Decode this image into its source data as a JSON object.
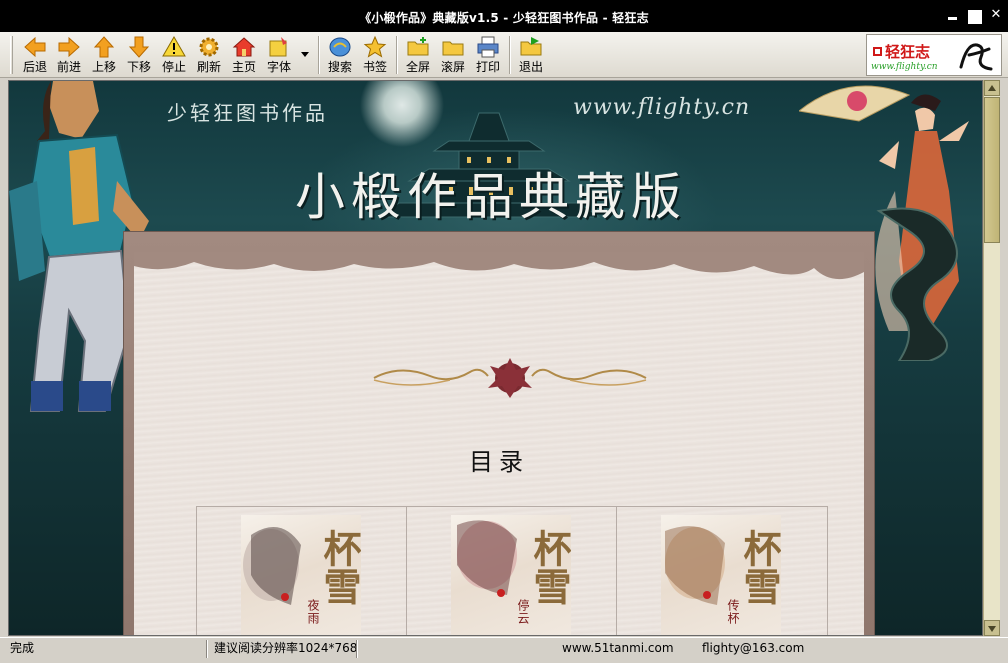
{
  "window": {
    "title": "《小椴作品》典藏版v1.5 - 少轻狂图书作品 - 轻狂志"
  },
  "toolbar": {
    "buttons": [
      {
        "label": "后退",
        "icon": "arrow-left-icon"
      },
      {
        "label": "前进",
        "icon": "arrow-right-icon"
      },
      {
        "label": "上移",
        "icon": "arrow-up-icon"
      },
      {
        "label": "下移",
        "icon": "arrow-down-icon"
      },
      {
        "label": "停止",
        "icon": "warning-icon"
      },
      {
        "label": "刷新",
        "icon": "refresh-gear-icon"
      },
      {
        "label": "主页",
        "icon": "home-icon"
      },
      {
        "label": "字体",
        "icon": "font-icon"
      },
      {
        "label": "搜索",
        "icon": "search-icon"
      },
      {
        "label": "书签",
        "icon": "star-icon"
      },
      {
        "label": "全屏",
        "icon": "folder-add-icon"
      },
      {
        "label": "滚屏",
        "icon": "folder-icon"
      },
      {
        "label": "打印",
        "icon": "printer-icon"
      },
      {
        "label": "退出",
        "icon": "exit-icon"
      }
    ],
    "logo": {
      "name": "轻狂志",
      "url": "www.flighty.cn"
    }
  },
  "banner": {
    "subtitle": "少轻狂图书作品",
    "url": "www.flighty.cn",
    "title": "小椴作品典藏版"
  },
  "toc": {
    "title": "目录",
    "books": [
      {
        "cover_big": "杯雪",
        "cover_label": "夜雨"
      },
      {
        "cover_big": "杯雪",
        "cover_label": "停云"
      },
      {
        "cover_big": "杯雪",
        "cover_label": "传杯"
      }
    ]
  },
  "statusbar": {
    "status": "完成",
    "hint": "建议阅读分辨率1024*768",
    "site": "www.51tanmi.com",
    "email": "flighty@163.com"
  },
  "colors": {
    "titlebar": "#000000",
    "banner": "#1d4a4f",
    "paper": "#ede6e1",
    "scrollbar": "#c8c090"
  }
}
